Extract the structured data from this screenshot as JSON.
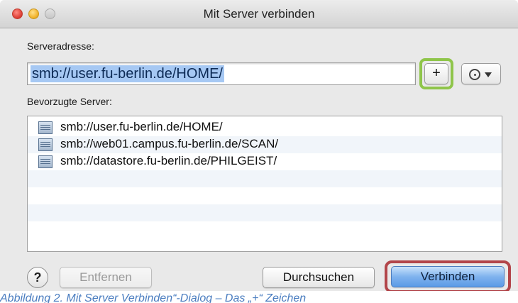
{
  "window": {
    "title": "Mit Server verbinden"
  },
  "server_address": {
    "label": "Serveradresse:",
    "value": "smb://user.fu-berlin.de/HOME/",
    "add_button": "+"
  },
  "favorites": {
    "label": "Bevorzugte Server:",
    "items": [
      "smb://user.fu-berlin.de/HOME/",
      "smb://web01.campus.fu-berlin.de/SCAN/",
      "smb://datastore.fu-berlin.de/PHILGEIST/"
    ]
  },
  "buttons": {
    "help": "?",
    "remove": "Entfernen",
    "browse": "Durchsuchen",
    "connect": "Verbinden"
  },
  "highlight_colors": {
    "plus_ring": "#8fc54a",
    "connect_ring": "#b2454a"
  },
  "caption": "Abbildung 2. Mit Server Verbinden“-Dialog – Das „+“ Zeichen"
}
